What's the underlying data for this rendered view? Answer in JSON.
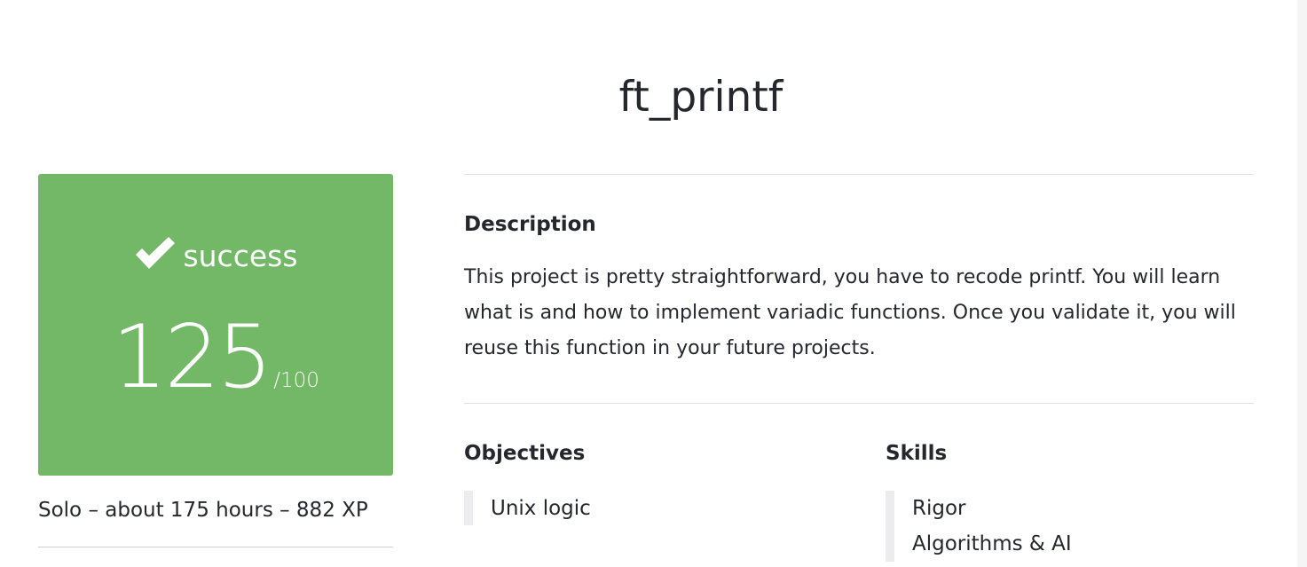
{
  "project": {
    "title": "ft_printf"
  },
  "score_card": {
    "status": "success",
    "status_icon": "check-icon",
    "score": "125",
    "max": "/100",
    "background_color": "#72b866"
  },
  "meta": {
    "line": "Solo – about 175 hours – 882 XP"
  },
  "description": {
    "heading": "Description",
    "text": "This project is pretty straightforward, you have to recode printf. You will learn what is and how to implement variadic functions. Once you validate it, you will reuse this function in your future projects."
  },
  "objectives": {
    "heading": "Objectives",
    "items": [
      "Unix logic"
    ]
  },
  "skills": {
    "heading": "Skills",
    "items": [
      "Rigor",
      "Algorithms & AI"
    ]
  }
}
